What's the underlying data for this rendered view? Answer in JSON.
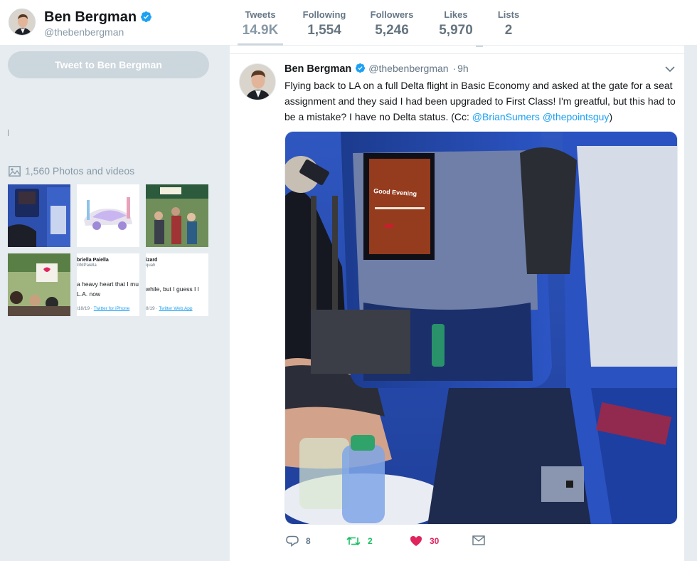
{
  "profile": {
    "name": "Ben Bergman",
    "handle": "@thebenbergman"
  },
  "stats": [
    {
      "label": "Tweets",
      "value": "14.9K"
    },
    {
      "label": "Following",
      "value": "1,554"
    },
    {
      "label": "Followers",
      "value": "5,246"
    },
    {
      "label": "Likes",
      "value": "5,970"
    },
    {
      "label": "Lists",
      "value": "2"
    }
  ],
  "sidebar": {
    "tweet_to_label": "Tweet to Ben Bergman",
    "photos_label": "1,560 Photos and videos",
    "tweet_thumb_1": {
      "name": "briella Paiella",
      "handle": "GMPaiella",
      "line1": "a heavy heart that I mu",
      "line2": "L.A. now",
      "date": "/18/19 · ",
      "via": "Twitter for iPhone"
    },
    "tweet_thumb_2": {
      "name": "izard",
      "handle": "quah",
      "line1": "while, but I guess I l",
      "date": "8/19 · ",
      "via": "Twitter Web App"
    }
  },
  "tweet": {
    "name": "Ben Bergman",
    "handle": "@thebenbergman",
    "dot": "·",
    "time": "9h",
    "text": "Flying back to LA on a full Delta flight in Basic Economy and asked at the gate for a seat assignment and they said I had been upgraded to First Class! I'm greatful, but this had to be a mistake? I have no Delta status. (Cc: ",
    "mention1": "@BrianSumers",
    "mention2": "@thepointsguy",
    "text_end": ")",
    "screen_text": "Good Evening",
    "replies": "8",
    "retweets": "2",
    "likes": "30"
  },
  "colors": {
    "brand": "#1da1f2",
    "like": "#e0245e",
    "retweet": "#17bf63",
    "muted": "#657786",
    "background": "#e6ecf0"
  },
  "icons": [
    "verified-badge-icon",
    "photo-icon",
    "reply-icon",
    "retweet-icon",
    "heart-icon",
    "direct-message-icon",
    "chevron-down-icon"
  ]
}
